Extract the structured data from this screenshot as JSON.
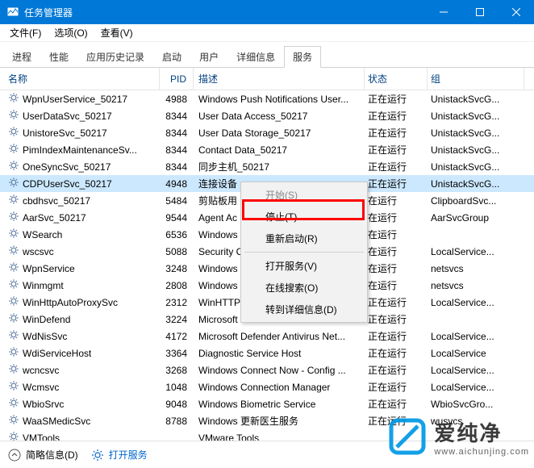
{
  "window": {
    "title": "任务管理器"
  },
  "menu": {
    "file": "文件(F)",
    "options": "选项(O)",
    "view": "查看(V)"
  },
  "tabs": {
    "processes": "进程",
    "performance": "性能",
    "apphistory": "应用历史记录",
    "startup": "启动",
    "users": "用户",
    "details": "详细信息",
    "services": "服务"
  },
  "columns": {
    "name": "名称",
    "pid": "PID",
    "description": "描述",
    "status": "状态",
    "group": "组"
  },
  "services": [
    {
      "name": "WpnUserService_50217",
      "pid": "4988",
      "desc": "Windows Push Notifications User...",
      "status": "正在运行",
      "group": "UnistackSvcG..."
    },
    {
      "name": "UserDataSvc_50217",
      "pid": "8344",
      "desc": "User Data Access_50217",
      "status": "正在运行",
      "group": "UnistackSvcG..."
    },
    {
      "name": "UnistoreSvc_50217",
      "pid": "8344",
      "desc": "User Data Storage_50217",
      "status": "正在运行",
      "group": "UnistackSvcG..."
    },
    {
      "name": "PimIndexMaintenanceSv...",
      "pid": "8344",
      "desc": "Contact Data_50217",
      "status": "正在运行",
      "group": "UnistackSvcG..."
    },
    {
      "name": "OneSyncSvc_50217",
      "pid": "8344",
      "desc": "同步主机_50217",
      "status": "正在运行",
      "group": "UnistackSvcG..."
    },
    {
      "name": "CDPUserSvc_50217",
      "pid": "4948",
      "desc": "连接设备",
      "status": "正在运行",
      "group": "UnistackSvcG..."
    },
    {
      "name": "cbdhsvc_50217",
      "pid": "5484",
      "desc": "剪贴板用",
      "status": "在运行",
      "group": "ClipboardSvc..."
    },
    {
      "name": "AarSvc_50217",
      "pid": "9544",
      "desc": "Agent Ac",
      "status": "在运行",
      "group": "AarSvcGroup"
    },
    {
      "name": "WSearch",
      "pid": "6536",
      "desc": "Windows",
      "status": "在运行",
      "group": ""
    },
    {
      "name": "wscsvc",
      "pid": "5088",
      "desc": "Security C",
      "status": "在运行",
      "group": "LocalService..."
    },
    {
      "name": "WpnService",
      "pid": "3248",
      "desc": "Windows",
      "status": "在运行",
      "group": "netsvcs"
    },
    {
      "name": "Winmgmt",
      "pid": "2808",
      "desc": "Windows",
      "status": "在运行",
      "group": "netsvcs"
    },
    {
      "name": "WinHttpAutoProxySvc",
      "pid": "2312",
      "desc": "WinHTTP Web Proxy Auto-Discov...",
      "status": "正在运行",
      "group": "LocalService..."
    },
    {
      "name": "WinDefend",
      "pid": "3224",
      "desc": "Microsoft Defender Antivirus Ser...",
      "status": "正在运行",
      "group": ""
    },
    {
      "name": "WdNisSvc",
      "pid": "4172",
      "desc": "Microsoft Defender Antivirus Net...",
      "status": "正在运行",
      "group": "LocalService..."
    },
    {
      "name": "WdiServiceHost",
      "pid": "3364",
      "desc": "Diagnostic Service Host",
      "status": "正在运行",
      "group": "LocalService"
    },
    {
      "name": "wcncsvc",
      "pid": "3268",
      "desc": "Windows Connect Now - Config ...",
      "status": "正在运行",
      "group": "LocalService..."
    },
    {
      "name": "Wcmsvc",
      "pid": "1048",
      "desc": "Windows Connection Manager",
      "status": "正在运行",
      "group": "LocalService..."
    },
    {
      "name": "WbioSrvc",
      "pid": "9048",
      "desc": "Windows Biometric Service",
      "status": "正在运行",
      "group": "WbioSvcGro..."
    },
    {
      "name": "WaaSMedicSvc",
      "pid": "8788",
      "desc": "Windows 更新医生服务",
      "status": "正在运行",
      "group": "wusvcs"
    },
    {
      "name": "VMTools",
      "pid": "",
      "desc": "VMware Tools",
      "status": "",
      "group": ""
    }
  ],
  "contextMenu": {
    "start": "开始(S)",
    "stop": "停止(T)",
    "restart": "重新启动(R)",
    "openServices": "打开服务(V)",
    "searchOnline": "在线搜索(O)",
    "goToDetails": "转到详细信息(D)"
  },
  "statusbar": {
    "fewer": "简略信息(D)",
    "openServices": "打开服务"
  },
  "watermark": {
    "brand": "爱纯净",
    "url": "www.aichunjing.com"
  }
}
